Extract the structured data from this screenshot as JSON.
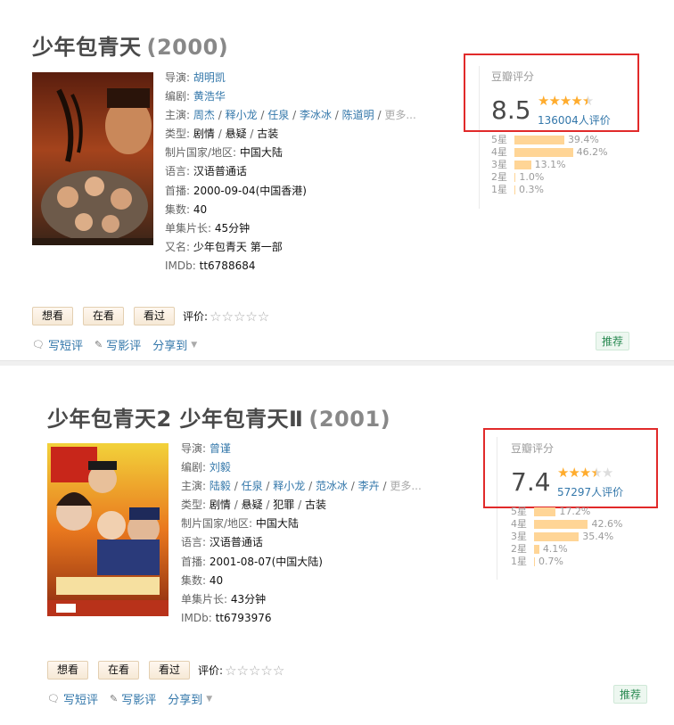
{
  "colors": {
    "link": "#3377aa",
    "star": "#ffac2d",
    "bar": "#ffd596",
    "highlight_box": "#e12a2a",
    "tag": "#2a8a52"
  },
  "entries": [
    {
      "title": "少年包青天",
      "year": "(2000)",
      "info": {
        "director_label": "导演:",
        "director": "胡明凯",
        "writer_label": "编剧:",
        "writer": "黄浩华",
        "cast_label": "主演:",
        "cast": [
          "周杰",
          "释小龙",
          "任泉",
          "李冰冰",
          "陈道明"
        ],
        "cast_more": "更多...",
        "genre_label": "类型:",
        "genres": [
          "剧情",
          "悬疑",
          "古装"
        ],
        "country_label": "制片国家/地区:",
        "country": "中国大陆",
        "language_label": "语言:",
        "language": "汉语普通话",
        "premiere_label": "首播:",
        "premiere": "2000-09-04(中国香港)",
        "episodes_label": "集数:",
        "episodes": "40",
        "runtime_label": "单集片长:",
        "runtime": "45分钟",
        "aka_label": "又名:",
        "aka": "少年包青天 第一部",
        "imdb_label": "IMDb:",
        "imdb": "tt6788684"
      },
      "rating": {
        "title": "豆瓣评分",
        "score": "8.5",
        "stars": 4.5,
        "votes": "136004人评价",
        "breakdown": [
          {
            "label": "5星",
            "percent": 39.4,
            "text": "39.4%"
          },
          {
            "label": "4星",
            "percent": 46.2,
            "text": "46.2%"
          },
          {
            "label": "3星",
            "percent": 13.1,
            "text": "13.1%"
          },
          {
            "label": "2星",
            "percent": 1.0,
            "text": "1.0%"
          },
          {
            "label": "1星",
            "percent": 0.3,
            "text": "0.3%"
          }
        ]
      },
      "actions": {
        "want": "想看",
        "watching": "在看",
        "watched": "看过",
        "rate_label": "评价:"
      },
      "links": {
        "short_review": "写短评",
        "review": "写影评",
        "share": "分享到"
      },
      "tag": "推荐"
    },
    {
      "title": "少年包青天2 少年包青天Ⅱ",
      "year": "(2001)",
      "info": {
        "director_label": "导演:",
        "director": "曾谨",
        "writer_label": "编剧:",
        "writer": "刘毅",
        "cast_label": "主演:",
        "cast": [
          "陆毅",
          "任泉",
          "释小龙",
          "范冰冰",
          "李卉"
        ],
        "cast_more": "更多...",
        "genre_label": "类型:",
        "genres": [
          "剧情",
          "悬疑",
          "犯罪",
          "古装"
        ],
        "country_label": "制片国家/地区:",
        "country": "中国大陆",
        "language_label": "语言:",
        "language": "汉语普通话",
        "premiere_label": "首播:",
        "premiere": "2001-08-07(中国大陆)",
        "episodes_label": "集数:",
        "episodes": "40",
        "runtime_label": "单集片长:",
        "runtime": "43分钟",
        "imdb_label": "IMDb:",
        "imdb": "tt6793976"
      },
      "rating": {
        "title": "豆瓣评分",
        "score": "7.4",
        "stars": 3.5,
        "votes": "57297人评价",
        "breakdown": [
          {
            "label": "5星",
            "percent": 17.2,
            "text": "17.2%"
          },
          {
            "label": "4星",
            "percent": 42.6,
            "text": "42.6%"
          },
          {
            "label": "3星",
            "percent": 35.4,
            "text": "35.4%"
          },
          {
            "label": "2星",
            "percent": 4.1,
            "text": "4.1%"
          },
          {
            "label": "1星",
            "percent": 0.7,
            "text": "0.7%"
          }
        ]
      },
      "actions": {
        "want": "想看",
        "watching": "在看",
        "watched": "看过",
        "rate_label": "评价:"
      },
      "links": {
        "short_review": "写短评",
        "review": "写影评",
        "share": "分享到"
      },
      "tag": "推荐"
    }
  ]
}
